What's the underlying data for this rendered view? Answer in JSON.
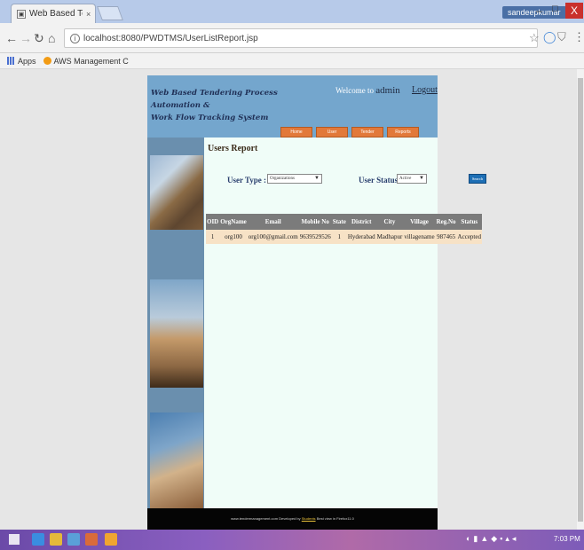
{
  "browser": {
    "tab_title": "Web Based Tendering Pr",
    "tab_close": "×",
    "user_badge": "sandeepkumar",
    "window_minimize": "–",
    "window_maximize": "□",
    "window_close": "X",
    "url": "localhost:8080/PWDTMS/UserListReport.jsp",
    "bookmarks": [
      "Apps",
      "AWS Management C"
    ]
  },
  "site": {
    "title_line1": "Web Based Tendering Process Automation &",
    "title_line2": "Work Flow Tracking System",
    "welcome_text": "Welcome to",
    "welcome_user": "admin",
    "logout": "Logout",
    "nav": [
      "Home",
      "User",
      "Tender",
      "Reports"
    ],
    "report_title": "Users Report",
    "filters": {
      "user_type_label": "User Type :",
      "user_type_value": "Organizations",
      "user_status_label": "User Status :",
      "user_status_value": "Active",
      "search_label": "Search"
    },
    "table": {
      "columns": [
        "OID",
        "OrgName",
        "Email",
        "Mobile No",
        "State",
        "District",
        "City",
        "Village",
        "Reg.No",
        "Status"
      ],
      "rows": [
        [
          "1",
          "org100",
          "org100@gmail.com",
          "9639529526",
          "1",
          "Hyderabad",
          "Madhapur",
          "villagename",
          "987465",
          "Accepted"
        ]
      ]
    },
    "footer_text": "www.tendermanagement.com  Developed by",
    "footer_dev": "Students",
    "footer_tail": "Best view in Firefox11.0"
  },
  "taskbar": {
    "clock": "7:03 PM"
  },
  "colors": {
    "header_blue": "#74a6cd",
    "nav_orange": "#e2793a",
    "content_bg": "#f0fdf8",
    "table_header": "#7b7b7b",
    "table_row": "#f7e2c6"
  }
}
